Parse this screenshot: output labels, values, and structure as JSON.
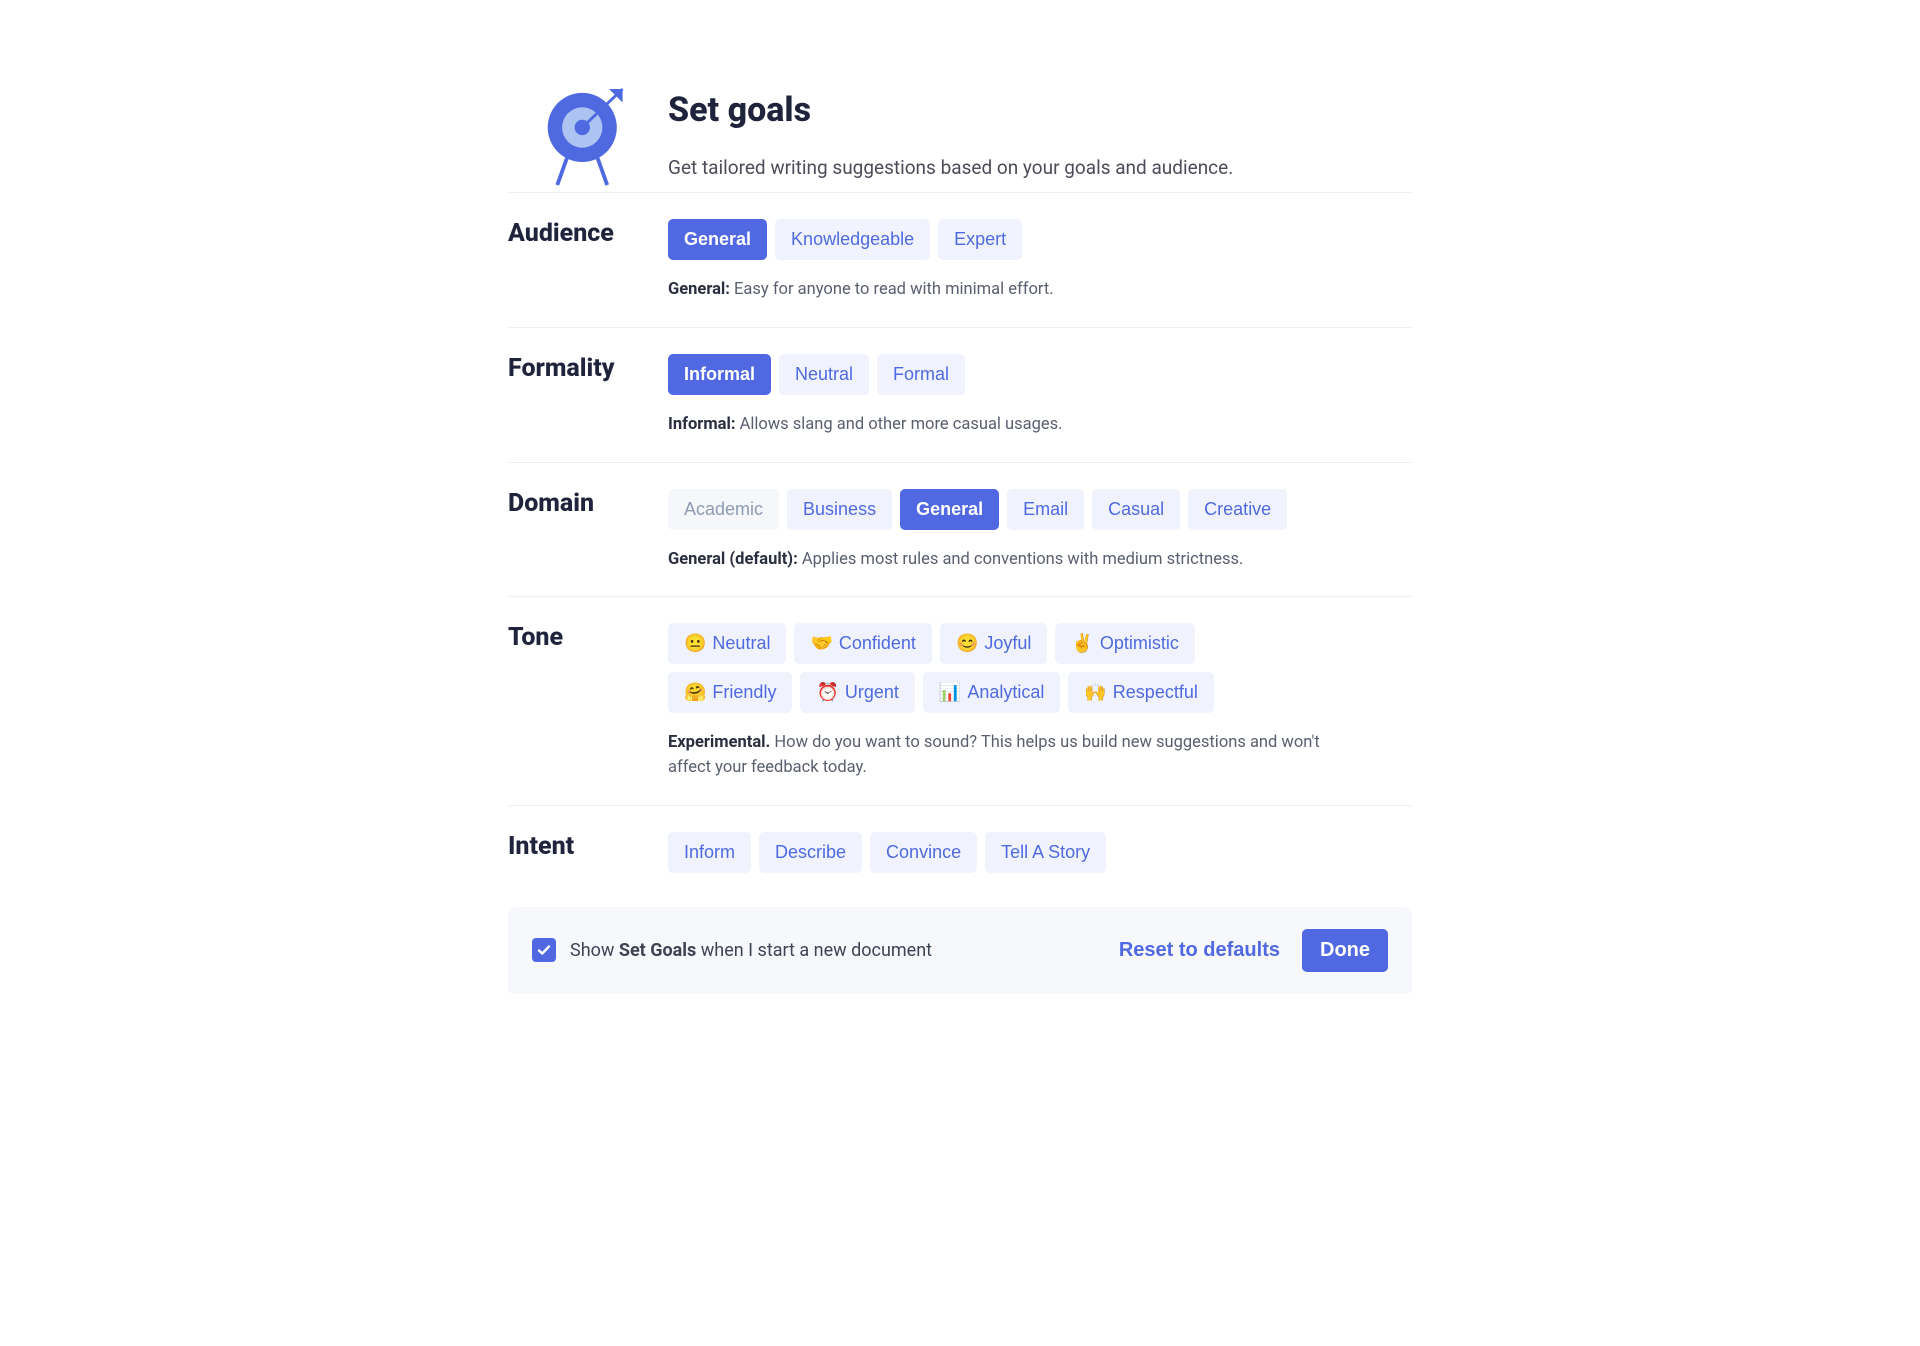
{
  "header": {
    "title": "Set goals",
    "subtitle": "Get tailored writing suggestions based on your goals and audience."
  },
  "sections": {
    "audience": {
      "label": "Audience",
      "options": [
        "General",
        "Knowledgeable",
        "Expert"
      ],
      "selected": "General",
      "desc_label": "General:",
      "desc_text": " Easy for anyone to read with minimal effort."
    },
    "formality": {
      "label": "Formality",
      "options": [
        "Informal",
        "Neutral",
        "Formal"
      ],
      "selected": "Informal",
      "desc_label": "Informal:",
      "desc_text": " Allows slang and other more casual usages."
    },
    "domain": {
      "label": "Domain",
      "options": [
        "Academic",
        "Business",
        "General",
        "Email",
        "Casual",
        "Creative"
      ],
      "selected": "General",
      "muted": [
        "Academic"
      ],
      "desc_label": "General (default):",
      "desc_text": " Applies most rules and conventions with medium strictness."
    },
    "tone": {
      "label": "Tone",
      "options": [
        {
          "emoji": "😐",
          "label": "Neutral"
        },
        {
          "emoji": "🤝",
          "label": "Confident"
        },
        {
          "emoji": "😊",
          "label": "Joyful"
        },
        {
          "emoji": "✌️",
          "label": "Optimistic"
        },
        {
          "emoji": "🤗",
          "label": "Friendly"
        },
        {
          "emoji": "⏰",
          "label": "Urgent"
        },
        {
          "emoji": "📊",
          "label": "Analytical"
        },
        {
          "emoji": "🙌",
          "label": "Respectful"
        }
      ],
      "desc_label": "Experimental.",
      "desc_text": " How do you want to sound? This helps us build new suggestions and won't affect your feedback today."
    },
    "intent": {
      "label": "Intent",
      "options": [
        "Inform",
        "Describe",
        "Convince",
        "Tell A Story"
      ]
    }
  },
  "footer": {
    "checkbox_checked": true,
    "label_pre": "Show ",
    "label_bold": "Set Goals",
    "label_post": " when I start a new document",
    "reset": "Reset to defaults",
    "done": "Done"
  }
}
